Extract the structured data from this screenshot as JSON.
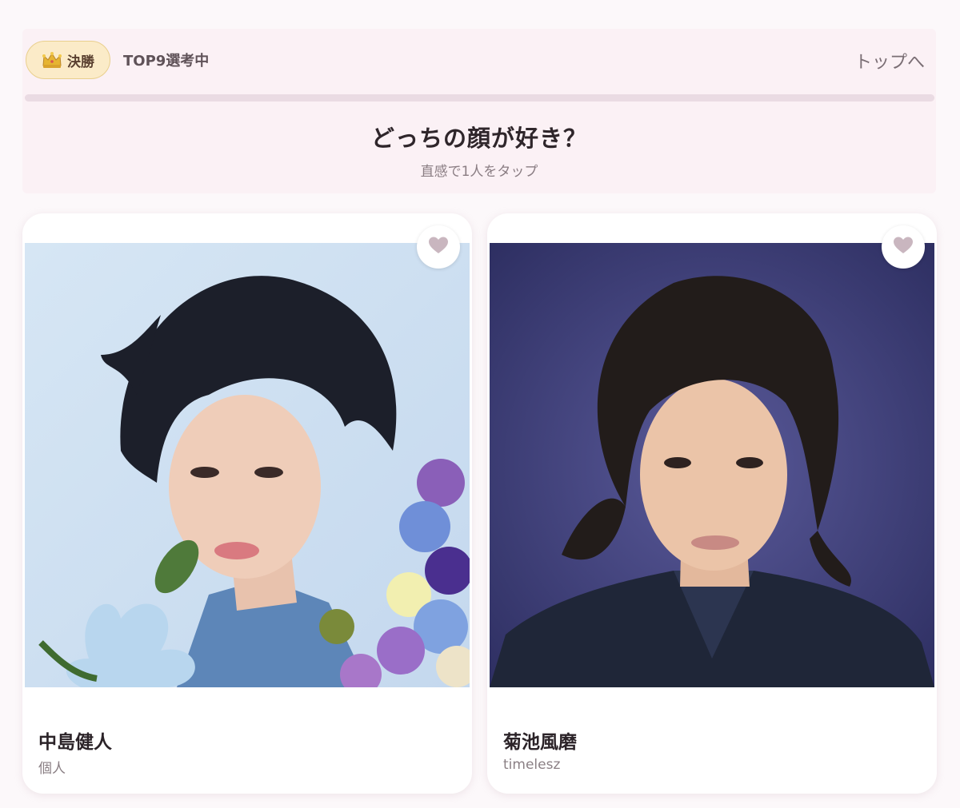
{
  "header": {
    "round_label": "決勝",
    "status": "TOP9選考中",
    "top_link": "トップへ",
    "progress_fraction": 1.0,
    "question": "どっちの顔が好き？",
    "hint": "直感で1人をタップ"
  },
  "candidates": [
    {
      "name": "中島健人",
      "group": "個人"
    },
    {
      "name": "菊池風磨",
      "group": "timelesz"
    }
  ],
  "colors": {
    "badge_bg": "#fbebc8",
    "heart": "#c9b6bf",
    "header_bg": "#fbf1f5"
  }
}
